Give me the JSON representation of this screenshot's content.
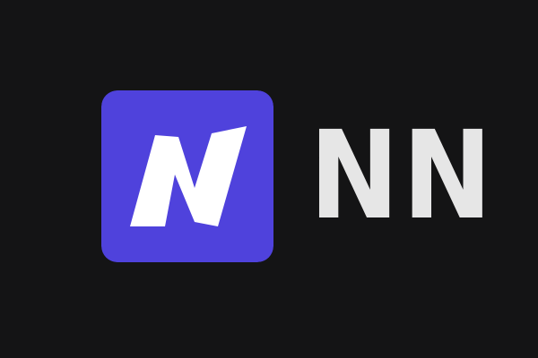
{
  "brand": {
    "logo_icon": "lightning-n-icon",
    "wordmark": "NN",
    "colors": {
      "background": "#141415",
      "logo_tile": "#4f42dc",
      "logo_glyph": "#ffffff",
      "wordmark": "#e6e6e6"
    }
  }
}
